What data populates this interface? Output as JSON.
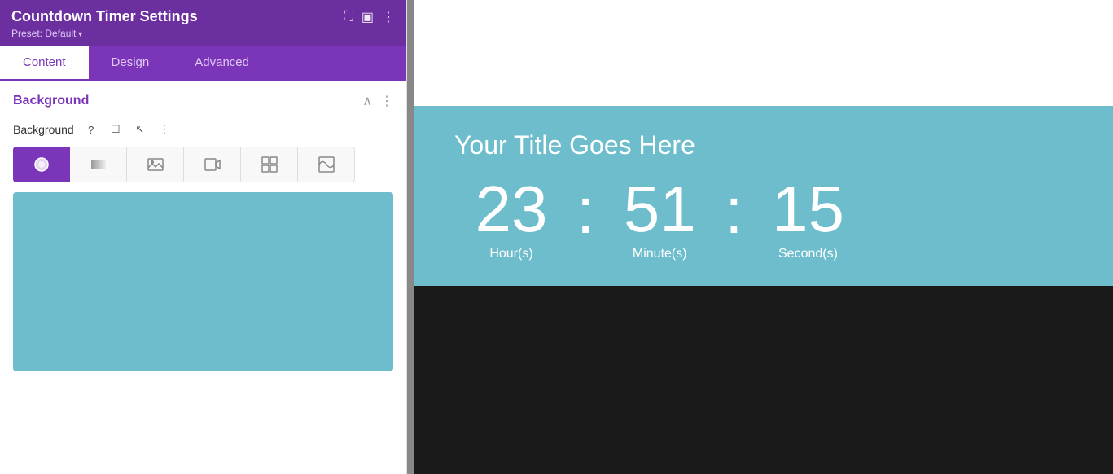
{
  "panel": {
    "title": "Countdown Timer Settings",
    "preset": "Preset: Default",
    "tabs": [
      {
        "label": "Content",
        "active": true
      },
      {
        "label": "Design",
        "active": false
      },
      {
        "label": "Advanced",
        "active": false
      }
    ],
    "section": {
      "title": "Background",
      "bg_label": "Background",
      "bg_types": [
        "color",
        "gradient",
        "image",
        "video",
        "pattern",
        "mask"
      ],
      "bg_type_icons": [
        "🎨",
        "▬",
        "🖼",
        "▶",
        "⊞",
        "◪"
      ],
      "color_preview_hex": "#6dbdcc"
    }
  },
  "canvas": {
    "timer_title": "Your Title Goes Here",
    "hours": "23",
    "minutes": "51",
    "seconds": "15",
    "hours_label": "Hour(s)",
    "minutes_label": "Minute(s)",
    "seconds_label": "Second(s)",
    "timer_bg": "#6dbdcc"
  },
  "icons": {
    "maximize": "⛶",
    "columns": "⊞",
    "more_vert": "⋮",
    "chevron_up": "∧",
    "help": "?",
    "mobile": "📱",
    "cursor": "↖",
    "section_more": "⋮"
  }
}
